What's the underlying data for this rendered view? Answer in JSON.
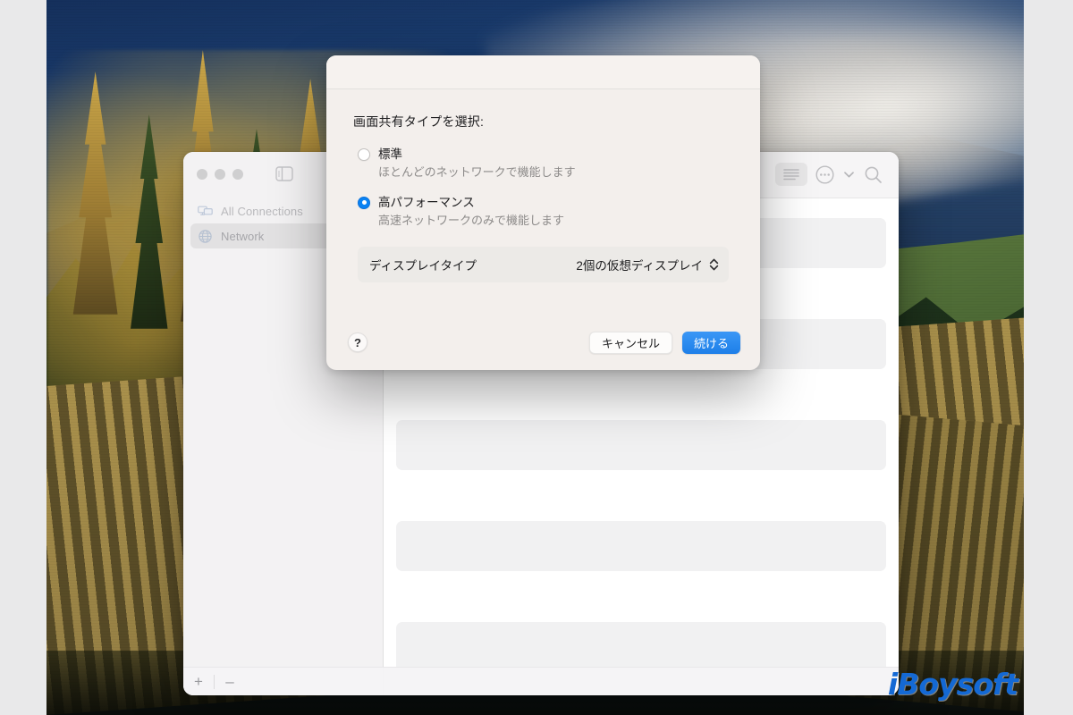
{
  "desktop": {
    "wallpaper_name": "autumn-mountain-vineyard-wallpaper"
  },
  "app_window": {
    "traffic_lights": [
      {
        "name": "close",
        "color": "#cfcfd0"
      },
      {
        "name": "minimize",
        "color": "#cfcfd0"
      },
      {
        "name": "zoom",
        "color": "#cfcfd0"
      }
    ],
    "sidebar_toggle_icon": "sidebar-toggle-icon",
    "sidebar": {
      "items": [
        {
          "label": "All Connections",
          "icon": "displays-icon",
          "selected": false
        },
        {
          "label": "Network",
          "icon": "globe-icon",
          "selected": true
        }
      ]
    },
    "toolbar": {
      "list_view_icon": "list-lines-icon",
      "more_options_icon": "ellipsis-circle-icon",
      "more_options_chevron_icon": "chevron-down-icon",
      "search_icon": "search-icon"
    },
    "bottom_bar": {
      "add_label": "+",
      "remove_label": "–"
    },
    "content_placeholders": 5
  },
  "sheet": {
    "title": "",
    "prompt": "画面共有タイプを選択:",
    "options": [
      {
        "title": "標準",
        "subtitle": "ほとんどのネットワークで機能します",
        "selected": false
      },
      {
        "title": "高パフォーマンス",
        "subtitle": "高速ネットワークのみで機能します",
        "selected": true
      }
    ],
    "display_setting": {
      "label": "ディスプレイタイプ",
      "value": "2個の仮想ディスプレイ",
      "stepper_icon": "up-down-chevron-icon"
    },
    "footer": {
      "help_label": "?",
      "cancel_label": "キャンセル",
      "continue_label": "続ける"
    },
    "accent_color": "#1d7fe8"
  },
  "watermark": {
    "prefix": "i",
    "text": "Boysoft",
    "color": "#1469d4"
  }
}
